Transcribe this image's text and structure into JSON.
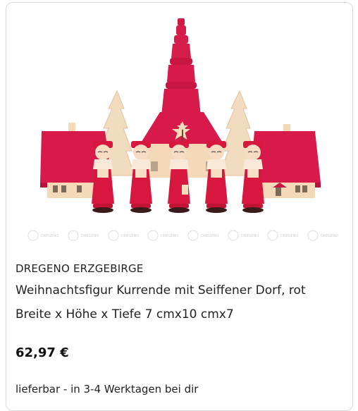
{
  "product": {
    "brand": "DREGENO ERZGEBIRGE",
    "title": "Weihnachtsfigur Kurrende mit Seiffener Dorf, rot",
    "dimensions": "Breite x Höhe x Tiefe 7 cmx10 cmx7",
    "price": "62,97 €",
    "availability": "lieferbar - in 3-4 Werktagen bei dir",
    "image_watermark": "DREGENO"
  },
  "colors": {
    "figure_red": "#d8173f",
    "church_red": "#d71a4a",
    "wood": "#f3d9b8"
  }
}
